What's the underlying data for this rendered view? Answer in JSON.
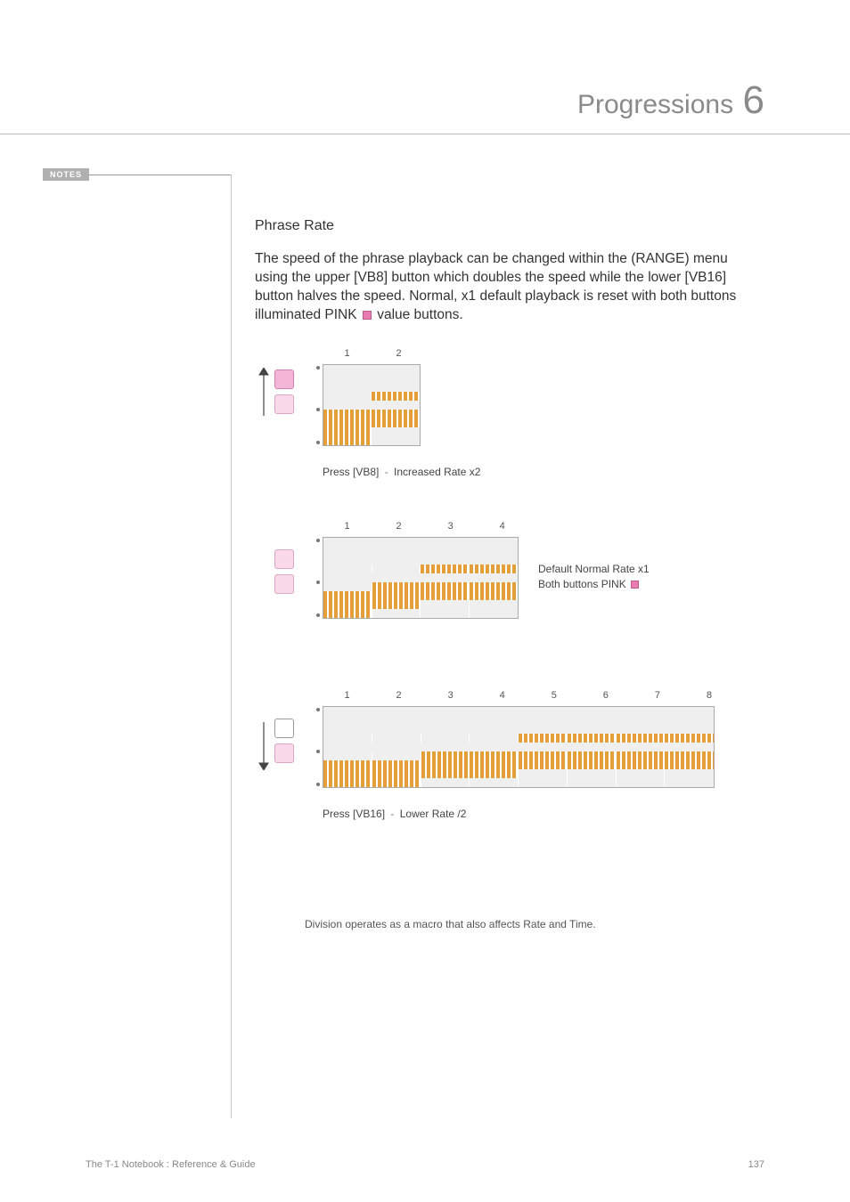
{
  "header": {
    "title": "Progressions",
    "chapter_number": "6"
  },
  "notes": {
    "label": "NOTES"
  },
  "main": {
    "section_title": "Phrase Rate",
    "para_a": "The speed of the phrase playback can be changed within the (RANGE) menu using the upper [VB8] button which doubles the speed while the lower [VB16] button halves the speed. Normal, x1 default playback is reset with both buttons illuminated PINK ",
    "para_b": " value buttons."
  },
  "diagrams": {
    "d1": {
      "cols": [
        "1",
        "2"
      ],
      "caption_a": "Press [VB8]",
      "caption_b": "Increased Rate x2"
    },
    "d2": {
      "cols": [
        "1",
        "2",
        "3",
        "4"
      ],
      "side_a": "Default Normal Rate x1",
      "side_b": "Both buttons PINK "
    },
    "d3": {
      "cols": [
        "1",
        "2",
        "3",
        "4",
        "5",
        "6",
        "7",
        "8"
      ],
      "caption_a": "Press [VB16]",
      "caption_b": "Lower Rate /2"
    },
    "footnote": "Division operates as a macro that also affects Rate and Time."
  },
  "footer": {
    "text": "The T-1 Notebook : Reference & Guide",
    "page": "137"
  }
}
